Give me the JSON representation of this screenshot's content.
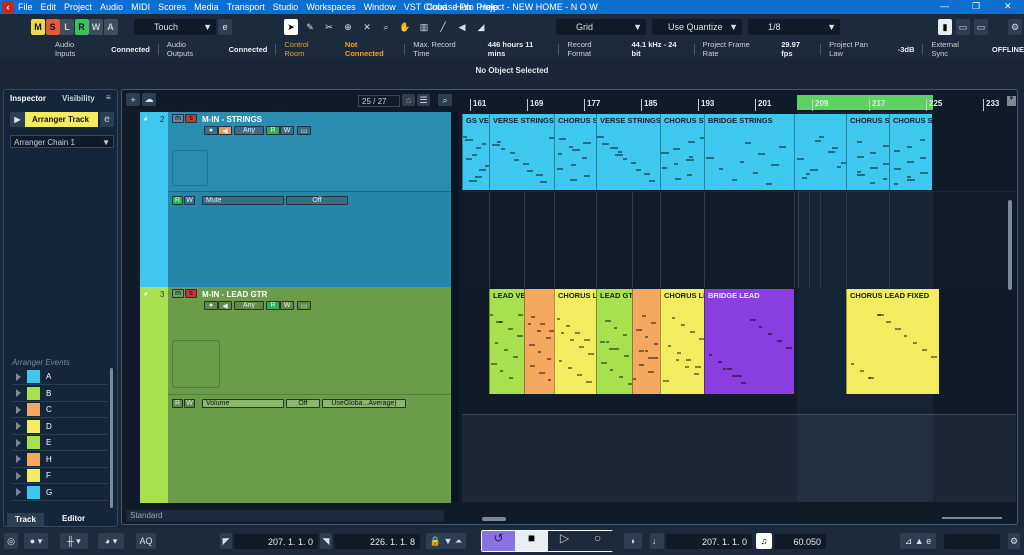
{
  "app": {
    "title": "Cubase Pro Project - NEW HOME - N O W",
    "menu": [
      "File",
      "Edit",
      "Project",
      "Audio",
      "MIDI",
      "Scores",
      "Media",
      "Transport",
      "Studio",
      "Workspaces",
      "Window",
      "VST Cloud",
      "Hub",
      "Help"
    ]
  },
  "toolbar": {
    "modes": [
      "M",
      "S",
      "L",
      "R",
      "W",
      "A"
    ],
    "automation_mode": "Touch",
    "snap_type": "Grid",
    "grid_type": "Use Quantize",
    "quantize": "1/8"
  },
  "status": [
    {
      "label": "Audio Inputs",
      "value": "Connected"
    },
    {
      "label": "Audio Outputs",
      "value": "Connected"
    },
    {
      "label": "Control Room",
      "value": "Not Connected",
      "warn": true
    },
    {
      "label": "Max. Record Time",
      "value": "446 hours 11 mins"
    },
    {
      "label": "Record Format",
      "value": "44.1 kHz - 24 bit"
    },
    {
      "label": "Project Frame Rate",
      "value": "29.97 fps"
    },
    {
      "label": "Project Pan Law",
      "value": "-3dB"
    },
    {
      "label": "External Sync",
      "value": "OFFLINE"
    }
  ],
  "info_line": "No Object Selected",
  "inspector": {
    "tabs": [
      "Inspector",
      "Visibility"
    ],
    "track_name": "Arranger Track",
    "chain": "Arranger Chain 1",
    "events_label": "Arranger Events",
    "events": [
      {
        "name": "A",
        "color": "#3ec8f0"
      },
      {
        "name": "B",
        "color": "#a8e050"
      },
      {
        "name": "C",
        "color": "#f4a860"
      },
      {
        "name": "D",
        "color": "#f4ec60"
      },
      {
        "name": "E",
        "color": "#a8e050"
      },
      {
        "name": "H",
        "color": "#f4a860"
      },
      {
        "name": "F",
        "color": "#f4ec60"
      },
      {
        "name": "G",
        "color": "#3ec8f0"
      }
    ],
    "bottom_tabs": [
      "Track",
      "Editor"
    ]
  },
  "tracklist": {
    "count": "25 / 27",
    "preset": "Standard",
    "tracks": [
      {
        "number": "2",
        "name": "M-IN - STRINGS",
        "input": "Any",
        "lane_param": "Mute",
        "lane_value": "Off"
      },
      {
        "number": "3",
        "name": "M-IN - LEAD GTR",
        "input": "Any",
        "lane_param": "Volume",
        "lane_value": "Off",
        "lane_mode": "UseGloba...Average)"
      }
    ]
  },
  "ruler": [
    "161",
    "169",
    "177",
    "185",
    "193",
    "201",
    "209",
    "217",
    "225",
    "233"
  ],
  "strings_parts": [
    "GS VERSE",
    "VERSE STRINGS",
    "CHORUS ST",
    "VERSE STRINGS",
    "CHORUS ST",
    "BRIDGE STRINGS",
    "",
    "CHORUS ST",
    "CHORUS ST"
  ],
  "lead_parts": [
    {
      "name": "LEAD VER",
      "color": "#a8e050"
    },
    {
      "name": "",
      "color": "#f4a860"
    },
    {
      "name": "CHORUS LE",
      "color": "#f4ec60"
    },
    {
      "name": "LEAD GTR",
      "color": "#a8e050"
    },
    {
      "name": "",
      "color": "#f4a860"
    },
    {
      "name": "CHORUS LE",
      "color": "#f4ec60"
    },
    {
      "name": "BRIDGE LEAD",
      "color": "#8a3ee0"
    },
    {
      "name": "CHORUS LEAD FIXED",
      "color": "#f4ec60"
    }
  ],
  "transport": {
    "left_locator": "207. 1. 1.   0",
    "right_locator": "226. 1. 1.   8",
    "position": "207. 1. 1.   0",
    "tempo": "60.050",
    "aq": "AQ"
  }
}
